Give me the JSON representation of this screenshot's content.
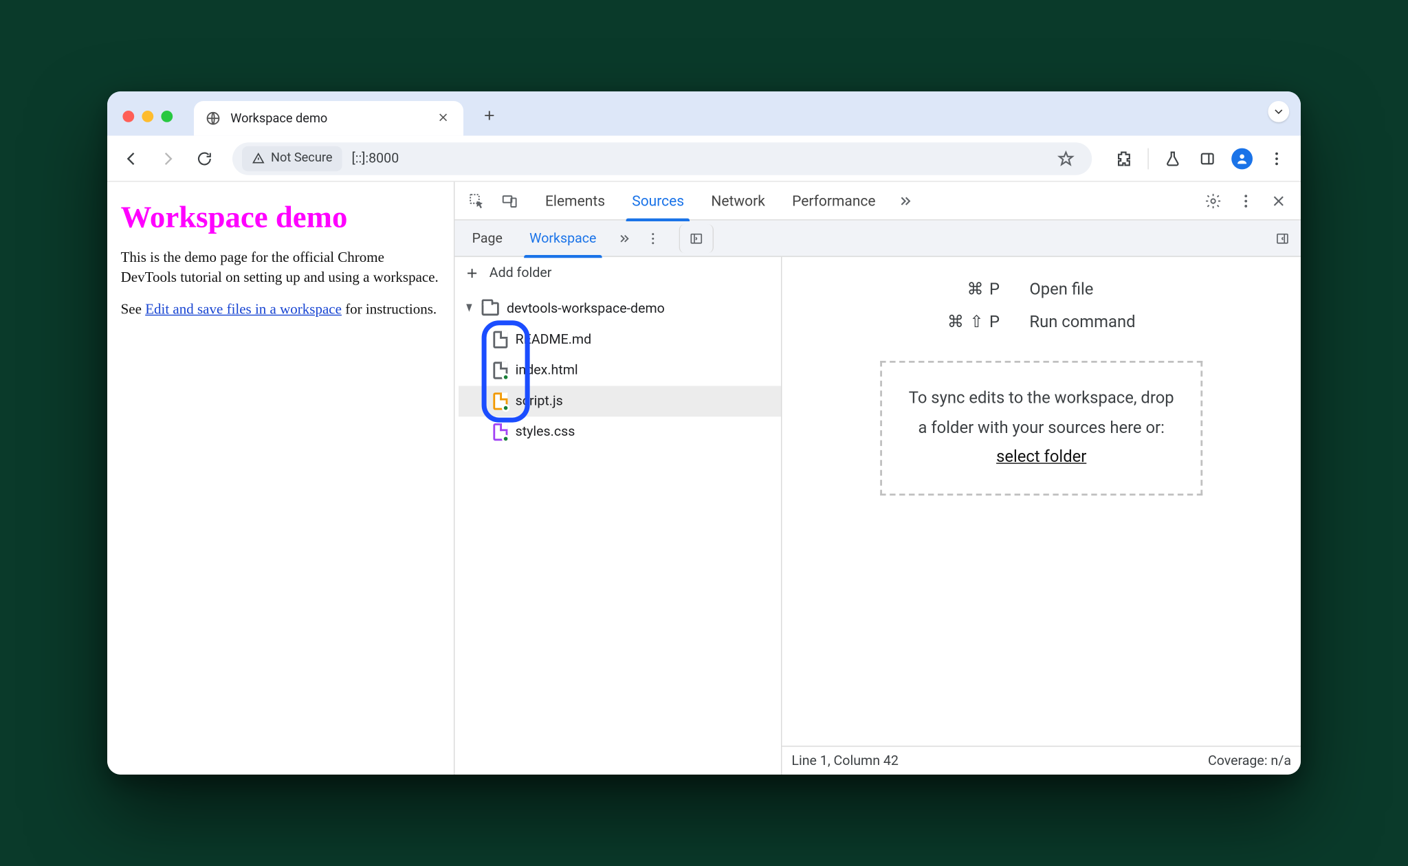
{
  "browser": {
    "tab_title": "Workspace demo",
    "not_secure_label": "Not Secure",
    "url": "[::]:8000"
  },
  "page": {
    "heading": "Workspace demo",
    "para1": "This is the demo page for the official Chrome DevTools tutorial on setting up and using a workspace.",
    "para2_prefix": "See ",
    "para2_link": "Edit and save files in a workspace",
    "para2_suffix": " for instructions."
  },
  "devtools": {
    "tabs": {
      "elements": "Elements",
      "sources": "Sources",
      "network": "Network",
      "performance": "Performance"
    },
    "sources": {
      "subtabs": {
        "page": "Page",
        "workspace": "Workspace"
      },
      "add_folder": "Add folder",
      "folder_name": "devtools-workspace-demo",
      "files": {
        "readme": "README.md",
        "index": "index.html",
        "script": "script.js",
        "styles": "styles.css"
      },
      "shortcuts": {
        "open_keys": "⌘ P",
        "open_label": "Open file",
        "run_keys": "⌘ ⇧ P",
        "run_label": "Run command"
      },
      "dropzone": {
        "line1": "To sync edits to the workspace, drop",
        "line2": "a folder with your sources here or:",
        "link": "select folder"
      }
    },
    "status": {
      "cursor": "Line 1, Column 42",
      "coverage": "Coverage: n/a"
    }
  }
}
